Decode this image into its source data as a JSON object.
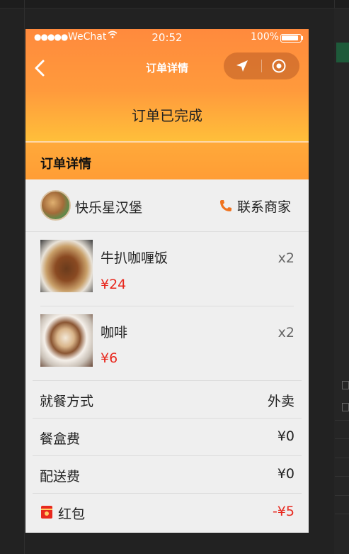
{
  "status_bar": {
    "signal": "●●●●●",
    "carrier": "WeChat",
    "time": "20:52",
    "battery": "100%"
  },
  "nav": {
    "title": "订单详情",
    "back_icon": "chevron-left-icon",
    "capsule_icons": [
      "location-arrow-icon",
      "record-icon"
    ]
  },
  "order": {
    "status": "订单已完成"
  },
  "section": {
    "title": "订单详情"
  },
  "shop": {
    "name": "快乐星汉堡",
    "contact_label": "联系商家",
    "contact_icon": "phone-icon"
  },
  "items": [
    {
      "name": "牛扒咖喱饭",
      "price": "¥24",
      "qty": "x2",
      "image": "curry-rice-image"
    },
    {
      "name": "咖啡",
      "price": "¥6",
      "qty": "x2",
      "image": "coffee-image"
    }
  ],
  "fees": [
    {
      "label": "就餐方式",
      "value": "外卖"
    },
    {
      "label": "餐盒费",
      "value": "¥0"
    },
    {
      "label": "配送费",
      "value": "¥0"
    },
    {
      "label": "红包",
      "value": "-¥5",
      "icon": "red-packet-icon"
    }
  ],
  "colors": {
    "header_top": "#ff8a3d",
    "header_bottom": "#ffbf3a",
    "price_red": "#e8281e",
    "page_bg": "#efefef"
  }
}
